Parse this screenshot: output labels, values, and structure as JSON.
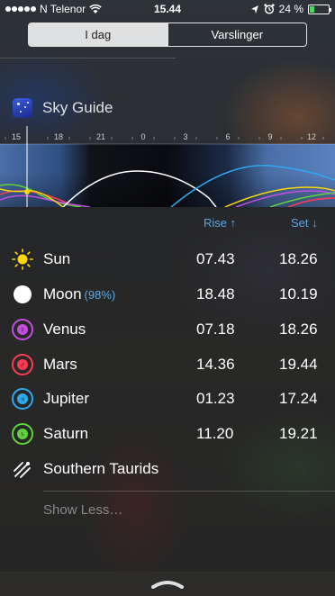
{
  "status_bar": {
    "carrier": "N Telenor",
    "time": "15.44",
    "battery_percent": "24 %",
    "battery_fill": 0.24
  },
  "tabs": [
    {
      "label": "I dag",
      "active": true
    },
    {
      "label": "Varslinger",
      "active": false
    }
  ],
  "widget": {
    "title": "Sky Guide",
    "timeline_ticks": [
      "15",
      "18",
      "21",
      "0",
      "3",
      "6",
      "9",
      "12"
    ]
  },
  "columns": {
    "rise": "Rise",
    "set": "Set"
  },
  "rows": [
    {
      "name": "Sun",
      "extra": "",
      "rise": "07.43",
      "set": "18.26",
      "icon": "sun-icon",
      "color": "#ffd60a"
    },
    {
      "name": "Moon",
      "extra": "(98%)",
      "rise": "18.48",
      "set": "10.19",
      "icon": "moon-icon",
      "color": "#ffffff"
    },
    {
      "name": "Venus",
      "extra": "",
      "rise": "07.18",
      "set": "18.26",
      "icon": "venus-icon",
      "color": "#c34fe0"
    },
    {
      "name": "Mars",
      "extra": "",
      "rise": "14.36",
      "set": "19.44",
      "icon": "mars-icon",
      "color": "#ff3b54"
    },
    {
      "name": "Jupiter",
      "extra": "",
      "rise": "01.23",
      "set": "17.24",
      "icon": "jupiter-icon",
      "color": "#2ea9f0"
    },
    {
      "name": "Saturn",
      "extra": "",
      "rise": "11.20",
      "set": "19.21",
      "icon": "saturn-icon",
      "color": "#5ed43a"
    },
    {
      "name": "Southern Taurids",
      "extra": "",
      "rise": "",
      "set": "",
      "icon": "meteor-shower-icon",
      "color": "#ffffff"
    }
  ],
  "show_less": "Show Less…"
}
